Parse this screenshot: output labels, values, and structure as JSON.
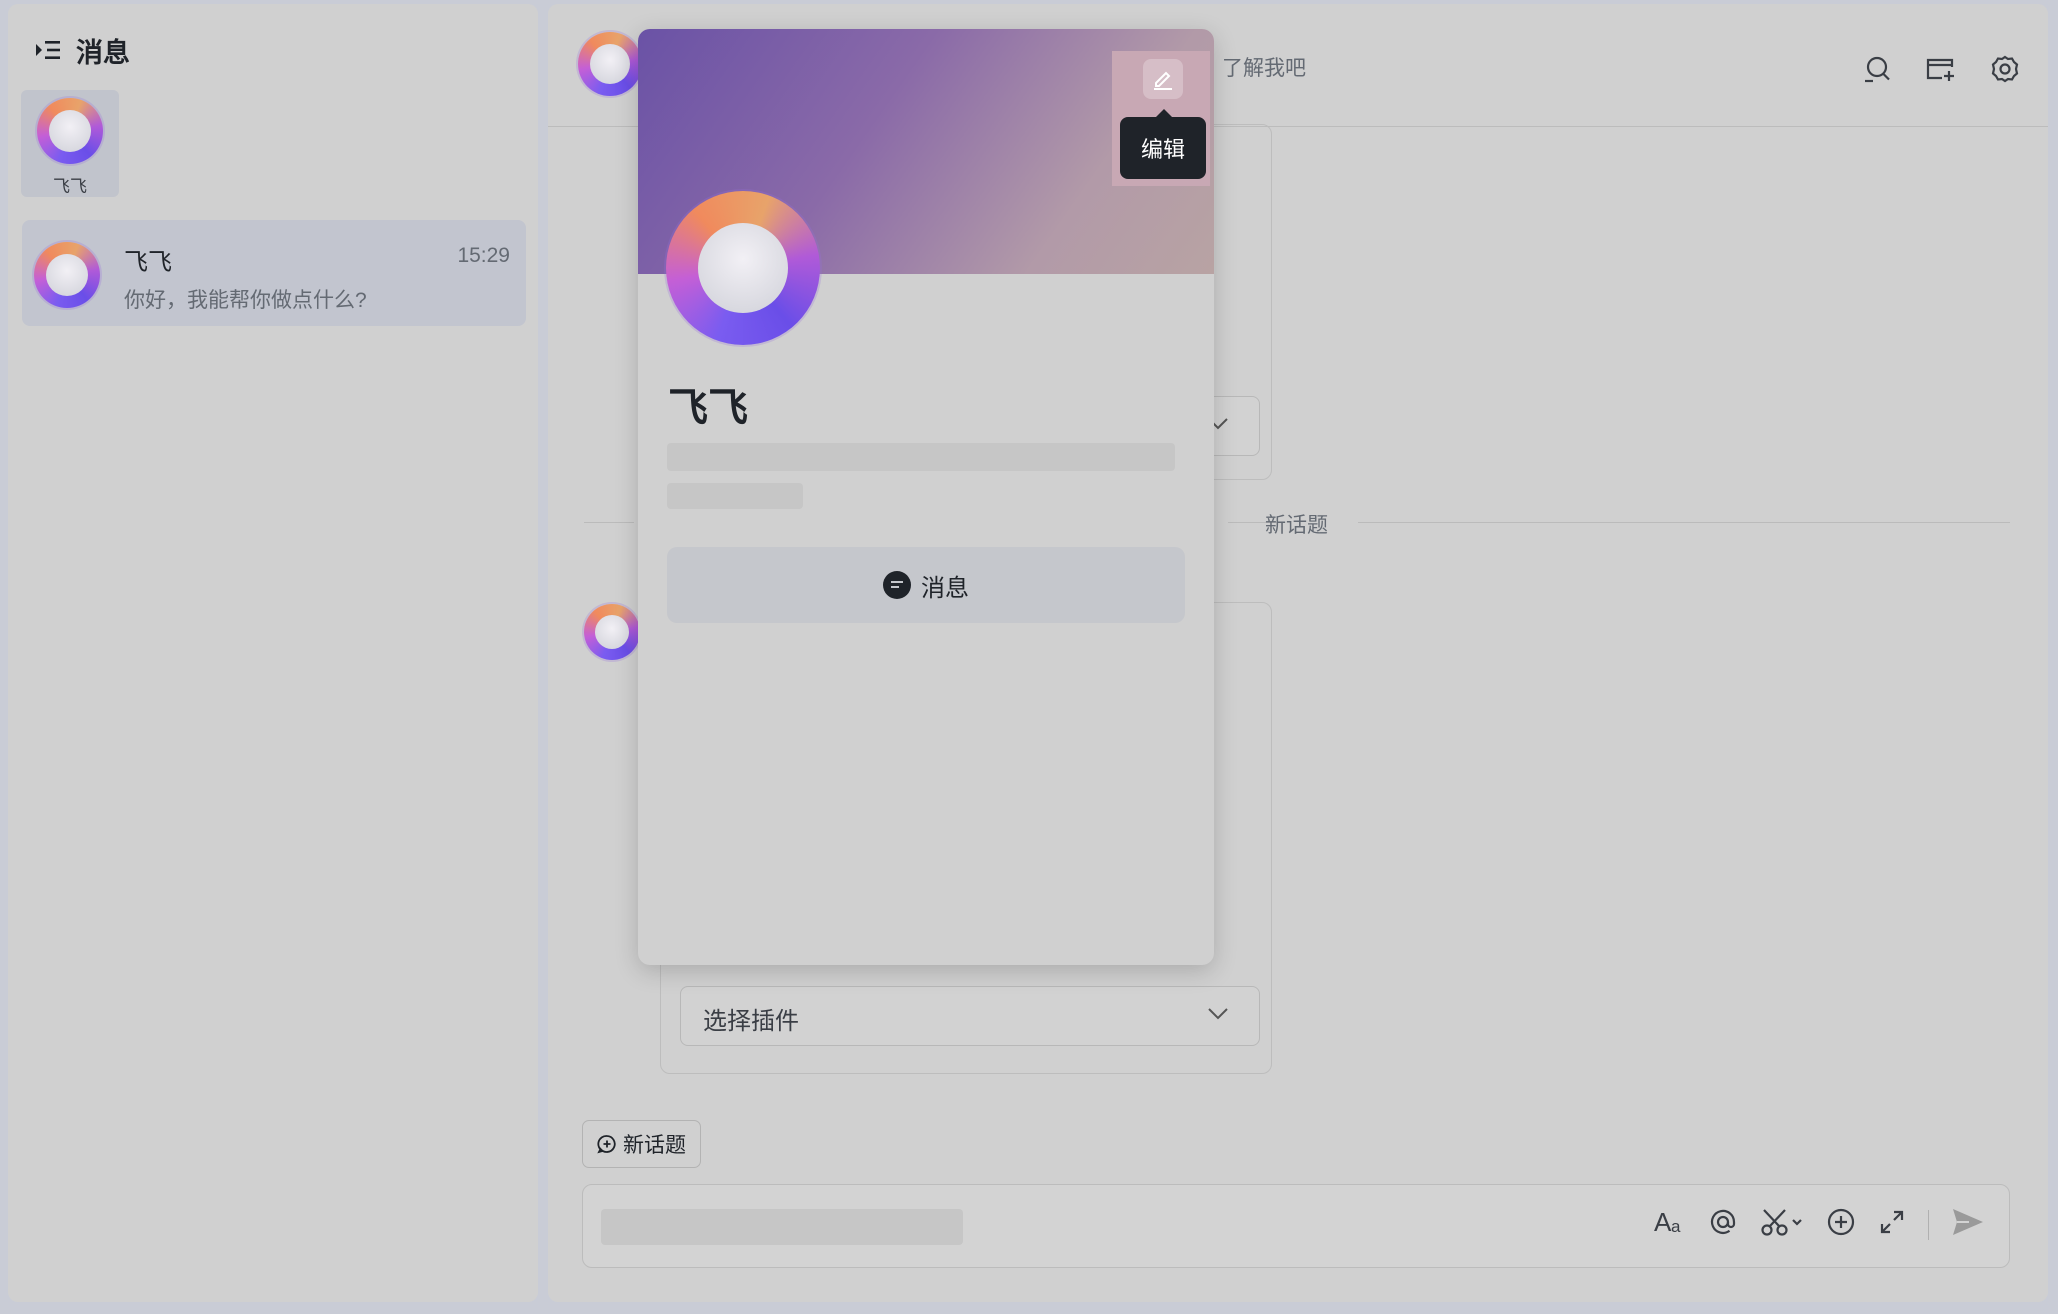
{
  "left_panel": {
    "title": "消息",
    "bot_tile": {
      "name": "飞飞"
    },
    "chat_list": [
      {
        "name": "飞飞",
        "time": "15:29",
        "preview": "你好，我能帮你做点什么?"
      }
    ]
  },
  "chat_header": {
    "subtitle_partial": "了解我吧",
    "tools": [
      "search-icon",
      "new-window-icon",
      "settings-icon"
    ]
  },
  "conversation": {
    "divider_label": "新话题",
    "plugin_select_placeholder": "选择插件"
  },
  "composer": {
    "new_topic_label": "新话题",
    "tools": [
      "text-format-icon",
      "mention-icon",
      "scissors-icon",
      "add-icon",
      "expand-icon",
      "send-icon"
    ]
  },
  "profile_card": {
    "name": "飞飞",
    "edit_tooltip": "编辑",
    "message_button_label": "消息"
  },
  "colors": {
    "overlay_bg": "#d0d0d0",
    "banner_start": "#6a52a6",
    "banner_end": "#b8a3a3",
    "tooltip_bg": "#1f2329"
  }
}
